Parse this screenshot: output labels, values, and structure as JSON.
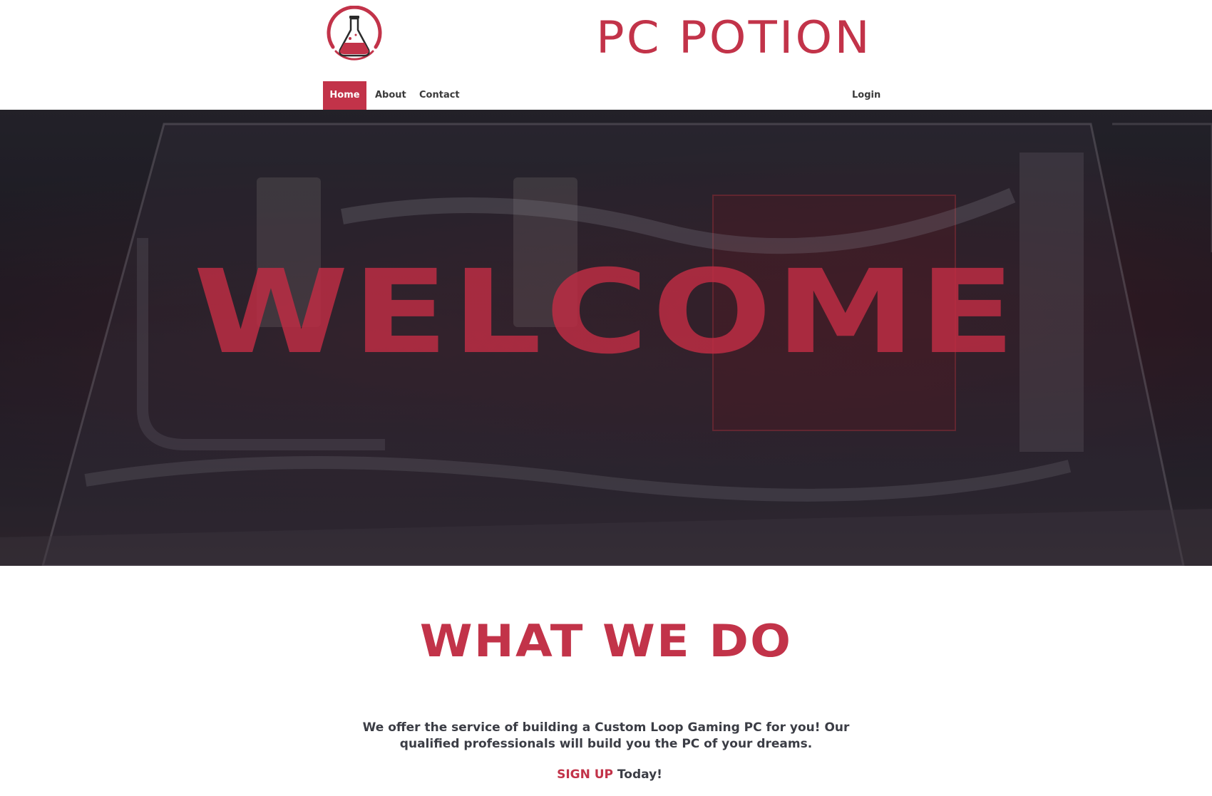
{
  "brand": {
    "name": "PC POTION",
    "logo_icon": "flask-icon",
    "accent_color": "#c23349"
  },
  "nav": {
    "items": [
      {
        "label": "Home",
        "active": true
      },
      {
        "label": "About",
        "active": false
      },
      {
        "label": "Contact",
        "active": false
      }
    ],
    "login_label": "Login"
  },
  "hero": {
    "title": "WELCOME"
  },
  "section": {
    "heading": "WHAT WE DO",
    "body": "We offer the service of building a Custom Loop Gaming PC for you! Our qualified professionals will build you the PC of your dreams.",
    "cta_link": "SIGN UP",
    "cta_suffix": " Today!"
  }
}
